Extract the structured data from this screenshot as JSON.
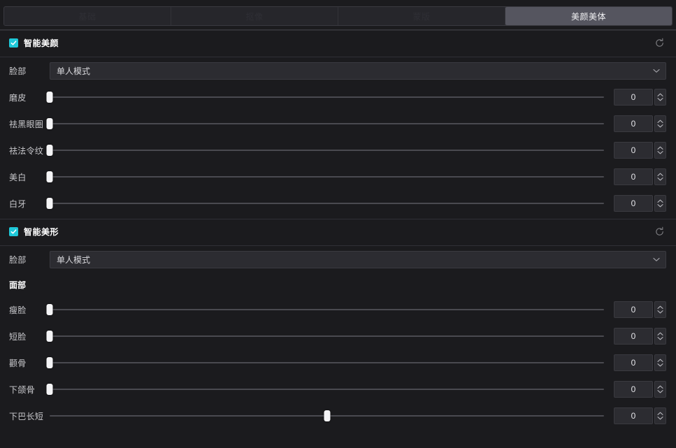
{
  "tabs": [
    {
      "label": "基础",
      "active": false
    },
    {
      "label": "抠像",
      "active": false
    },
    {
      "label": "蒙版",
      "active": false
    },
    {
      "label": "美颜美体",
      "active": true
    }
  ],
  "colors": {
    "accent": "#1ec8d8",
    "panel_bg": "#1b1b1e",
    "field_bg": "#2c2c31",
    "active_tab_bg": "#55555f",
    "slider_handle": "#f4f4f6",
    "track": "#4a4a50"
  },
  "icons": {
    "check": "check-icon",
    "reset": "reset-icon",
    "chevron_down": "chevron-down-icon",
    "spin_up": "spinner-up-icon",
    "spin_down": "spinner-down-icon"
  },
  "sections": [
    {
      "title": "智能美颜",
      "checked": true,
      "reset_label": "重置",
      "mode_label": "脸部",
      "mode_value": "单人模式",
      "sliders": [
        {
          "label": "磨皮",
          "value": "0",
          "pos": 0
        },
        {
          "label": "祛黑眼圈",
          "value": "0",
          "pos": 0
        },
        {
          "label": "祛法令纹",
          "value": "0",
          "pos": 0
        },
        {
          "label": "美白",
          "value": "0",
          "pos": 0
        },
        {
          "label": "白牙",
          "value": "0",
          "pos": 0
        }
      ]
    },
    {
      "title": "智能美形",
      "checked": true,
      "reset_label": "重置",
      "mode_label": "脸部",
      "mode_value": "单人模式",
      "subheading": "面部",
      "sliders": [
        {
          "label": "瘦脸",
          "value": "0",
          "pos": 0
        },
        {
          "label": "短脸",
          "value": "0",
          "pos": 0
        },
        {
          "label": "颧骨",
          "value": "0",
          "pos": 0
        },
        {
          "label": "下颌骨",
          "value": "0",
          "pos": 0
        },
        {
          "label": "下巴长短",
          "value": "0",
          "pos": 50
        }
      ]
    }
  ]
}
